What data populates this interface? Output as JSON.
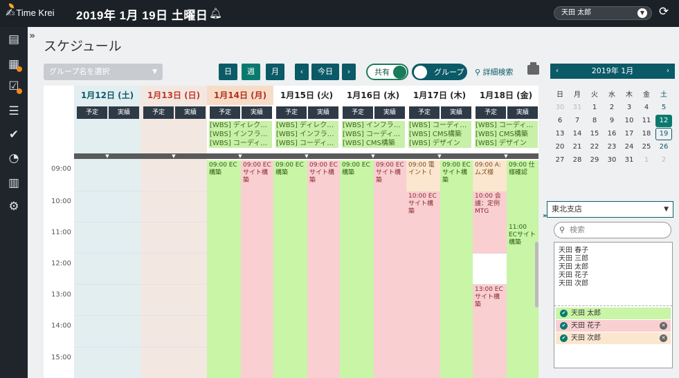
{
  "app": {
    "logo_text": "Time Krei",
    "date_title": "2019年 1月 19日 土曜日",
    "user": "天田 太郎"
  },
  "page": {
    "title": "スケジュール"
  },
  "toolbar": {
    "group_placeholder": "グループ名を選択",
    "day": "日",
    "week": "週",
    "month": "月",
    "prev": "‹",
    "today": "今日",
    "next": "›",
    "share": "共有",
    "group": "グループ",
    "detail_search": "詳細検索"
  },
  "calendar": {
    "days": [
      {
        "label": "1月12日 (土)",
        "kind": "sat"
      },
      {
        "label": "1月13日 (日)",
        "kind": "sun"
      },
      {
        "label": "1月14日 (月)",
        "kind": "today"
      },
      {
        "label": "1月15日 (火)",
        "kind": "weekday"
      },
      {
        "label": "1月16日 (水)",
        "kind": "weekday"
      },
      {
        "label": "1月17日 (木)",
        "kind": "weekday"
      },
      {
        "label": "1月18日 (金)",
        "kind": "weekday"
      }
    ],
    "tab_plan": "予定",
    "tab_actual": "実績",
    "allday": {
      "d14": [
        "[WBS] ディレク…",
        "[WBS] インフラ…",
        "[WBS] コーディ…"
      ],
      "d15": [
        "[WBS] ディレク…",
        "[WBS] インフラ…",
        "[WBS] コーディ…"
      ],
      "d16": [
        "[WBS] インフラ…",
        "[WBS] コーディ…",
        "[WBS] CMS構築"
      ],
      "d17": [
        "[WBS] コーディ…",
        "[WBS] CMS構築",
        "[WBS] デザイン"
      ],
      "d18": [
        "[WBS] コーディ…",
        "[WBS] CMS構築",
        "[WBS] デザイン"
      ]
    },
    "hours": [
      "09:00",
      "10:00",
      "11:00",
      "12:00",
      "13:00",
      "14:00",
      "15:00"
    ],
    "events": {
      "d14_plan": "09:00 EC 構築",
      "d14_actual": "09:00 ECサイト構築",
      "d15_plan": "09:00 EC 構築",
      "d15_actual": "09:00 ECサイト構築",
      "d16_plan": "09:00 EC 構築",
      "d16_actual": "09:00 ECサイト構築",
      "d17_plan_1": "09:00 電 イント (",
      "d17_plan_2": "10:00 ECサイト構築",
      "d17_actual": "09:00 ECサイト構築",
      "d18_plan_1": "09:00 A: ムズ様",
      "d18_plan_2": "10:00 会議：定例MTG",
      "d18_plan_3": "13:00 ECサイト構築",
      "d18_actual_1": "09:00 仕様確認",
      "d18_actual_2": "11:00 ECサイト構築"
    }
  },
  "minical": {
    "title": "2019年 1月",
    "weekdays": [
      "日",
      "月",
      "火",
      "水",
      "木",
      "金",
      "土"
    ],
    "weeks": [
      [
        "30",
        "31",
        "1",
        "2",
        "3",
        "4",
        "5"
      ],
      [
        "6",
        "7",
        "8",
        "9",
        "10",
        "11",
        "12"
      ],
      [
        "13",
        "14",
        "15",
        "16",
        "17",
        "18",
        "19"
      ],
      [
        "20",
        "21",
        "22",
        "23",
        "24",
        "25",
        "26"
      ],
      [
        "27",
        "28",
        "29",
        "30",
        "31",
        "1",
        "2"
      ]
    ]
  },
  "panel": {
    "branch": "東北支店",
    "search_placeholder": "検索",
    "users": [
      "天田 春子",
      "天田 三郎",
      "天田 太郎",
      "天田 花子",
      "天田 次郎"
    ],
    "selected": [
      "天田 太郎",
      "天田 花子",
      "天田 次郎"
    ]
  },
  "colors": {
    "accent": "#0b5a67",
    "event_green": "#c8f5a6",
    "event_pink": "#f9cfd2",
    "today_head": "#f7ddc8"
  }
}
